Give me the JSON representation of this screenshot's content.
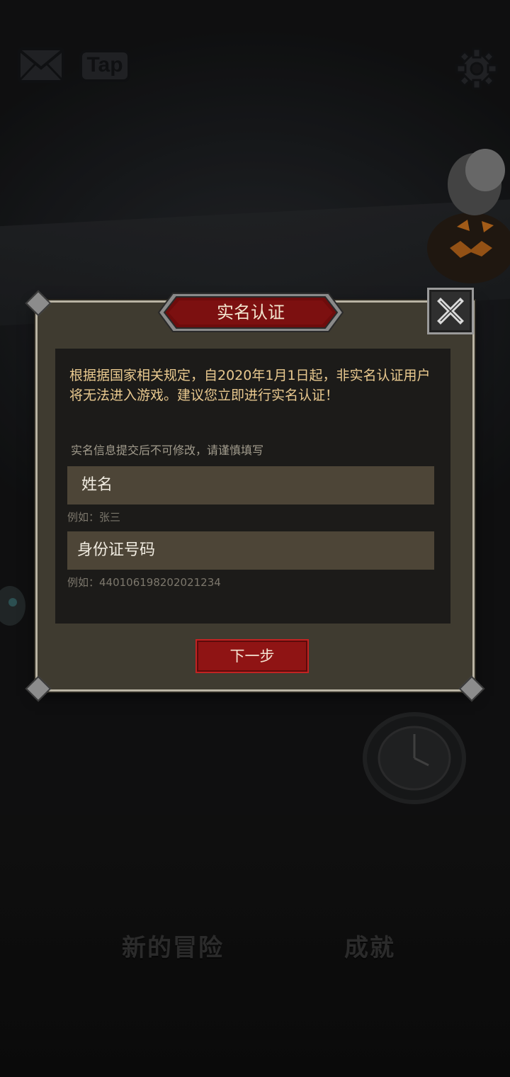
{
  "top_bar": {
    "mail_icon": "mail-icon",
    "tap_badge": "Tap",
    "settings_icon": "gear-icon"
  },
  "menu": {
    "new_adventure": "新的冒险",
    "achievements": "成就"
  },
  "dialog": {
    "title": "实名认证",
    "notice": "根据据国家相关规定，自2020年1月1日起，非实名认证用户将无法进入游戏。建议您立即进行实名认证！",
    "hint": "实名信息提交后不可修改，请谨慎填写",
    "name_field": {
      "placeholder": "姓名",
      "example": "例如：张三"
    },
    "id_field": {
      "placeholder": "身份证号码",
      "example": "例如：440106198202021234"
    },
    "next_button": "下一步",
    "close_icon": "close-icon"
  },
  "colors": {
    "accent_red": "#8f1414",
    "notice_text": "#e9c98f",
    "field_bg": "#4d4537"
  }
}
